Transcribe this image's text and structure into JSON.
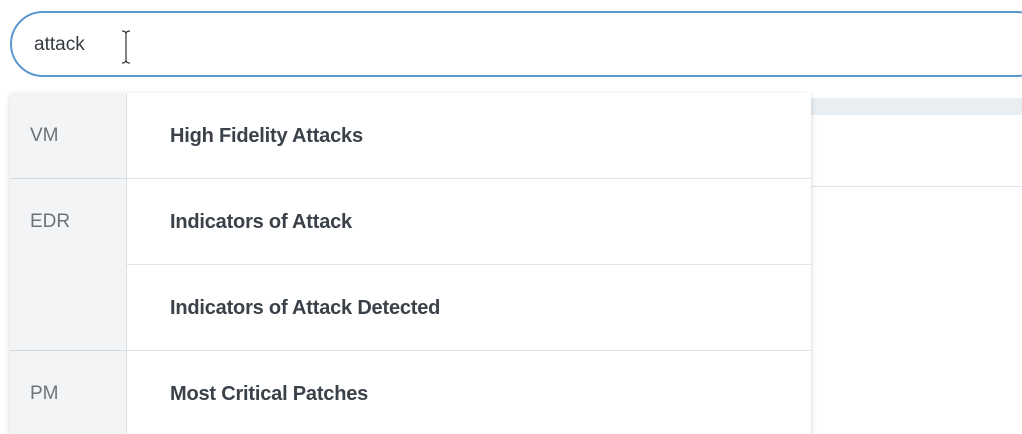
{
  "search": {
    "value": "attack"
  },
  "dropdown": {
    "rows": [
      {
        "category": "VM",
        "label": "High Fidelity Attacks"
      },
      {
        "category": "EDR",
        "label": "Indicators of Attack"
      },
      {
        "category": "",
        "label": "Indicators of Attack Detected"
      },
      {
        "category": "PM",
        "label": "Most Critical Patches"
      }
    ]
  },
  "colors": {
    "input_border": "#5b98cf",
    "category_bg": "#f3f4f5",
    "item_text": "#3a4148",
    "category_text": "#6c737a"
  }
}
